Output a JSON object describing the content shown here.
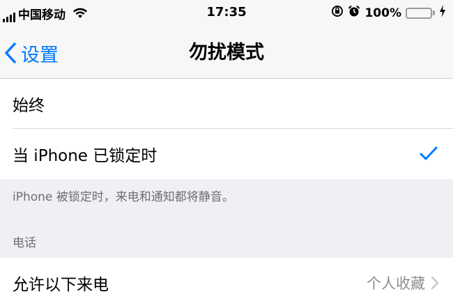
{
  "status_bar": {
    "carrier": "中国移动",
    "time": "17:35",
    "battery_percent": "100%",
    "battery_level": 1.0,
    "icons": [
      "signal-icon",
      "wifi-icon",
      "orientation-lock-icon",
      "alarm-icon",
      "battery-icon",
      "charging-icon"
    ]
  },
  "nav": {
    "back_label": "设置",
    "title": "勿扰模式"
  },
  "silence_options": [
    {
      "label": "始终",
      "checked": false
    },
    {
      "label": "当 iPhone 已锁定时",
      "checked": true
    }
  ],
  "silence_footer": "iPhone 被锁定时，来电和通知都将静音。",
  "phone_section": {
    "header": "电话",
    "allow_calls_label": "允许以下来电",
    "allow_calls_value": "个人收藏"
  },
  "colors": {
    "accent": "#007aff",
    "battery": "#4cd964",
    "background": "#efeff4"
  }
}
